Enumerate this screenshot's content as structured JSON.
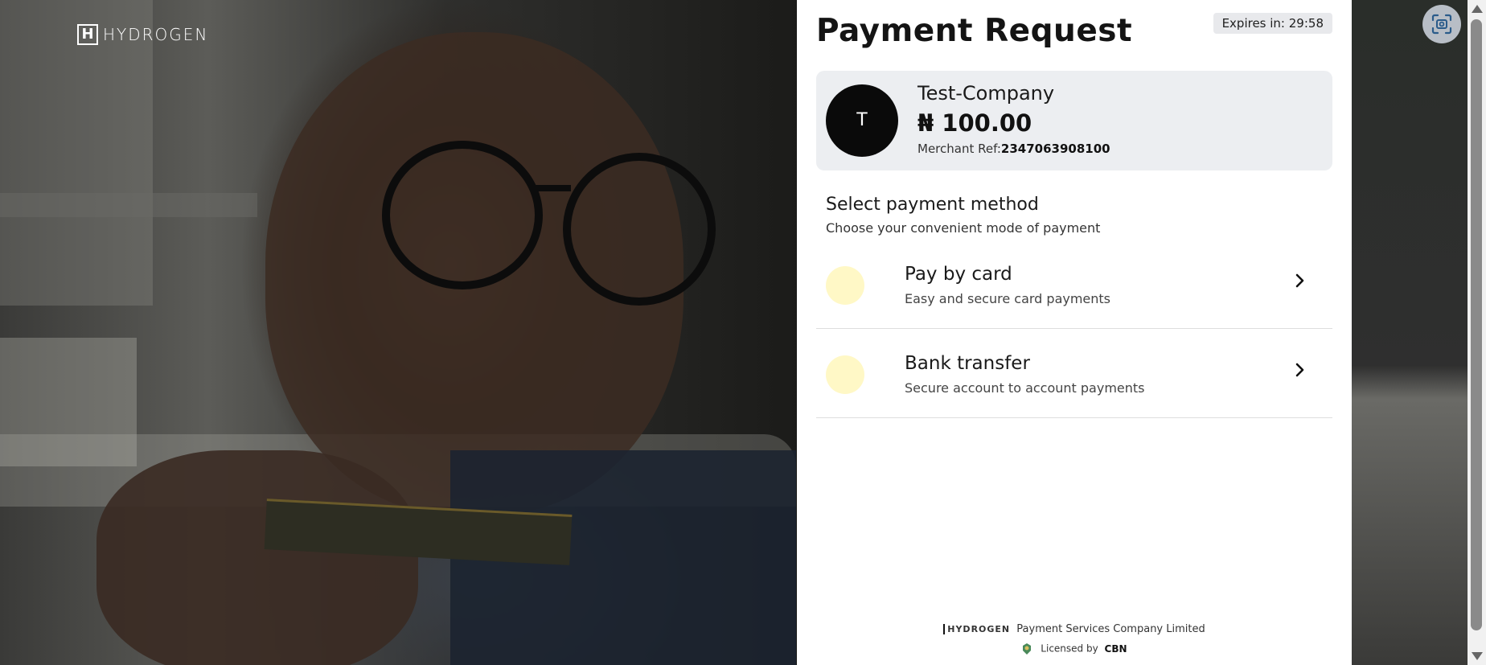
{
  "brand": {
    "logo_mark": "H",
    "logo_text": "HYDROGEN"
  },
  "panel": {
    "title": "Payment Request",
    "expires_label": "Expires in:",
    "expires_time": "29:58"
  },
  "merchant": {
    "avatar_letter": "T",
    "name": "Test-Company",
    "currency_symbol": "₦",
    "amount": "100.00",
    "ref_label": "Merchant Ref:",
    "ref_value": "2347063908100"
  },
  "payment_methods": {
    "title": "Select payment method",
    "subtitle": "Choose your convenient mode of payment",
    "options": [
      {
        "title": "Pay by card",
        "subtitle": "Easy and secure card payments",
        "icon": "chevron-right-icon"
      },
      {
        "title": "Bank transfer",
        "subtitle": "Secure account to account payments",
        "icon": "chevron-right-icon"
      }
    ]
  },
  "footer": {
    "mini_logo": "HYDROGEN",
    "company": "Payment Services Company Limited",
    "licensed_label": "Licensed by",
    "licensor": "CBN"
  },
  "colors": {
    "panel_bg": "#ffffff",
    "card_bg": "#eceef1",
    "option_circle": "#fff8c6",
    "avatar_bg": "#0a0a0a"
  }
}
